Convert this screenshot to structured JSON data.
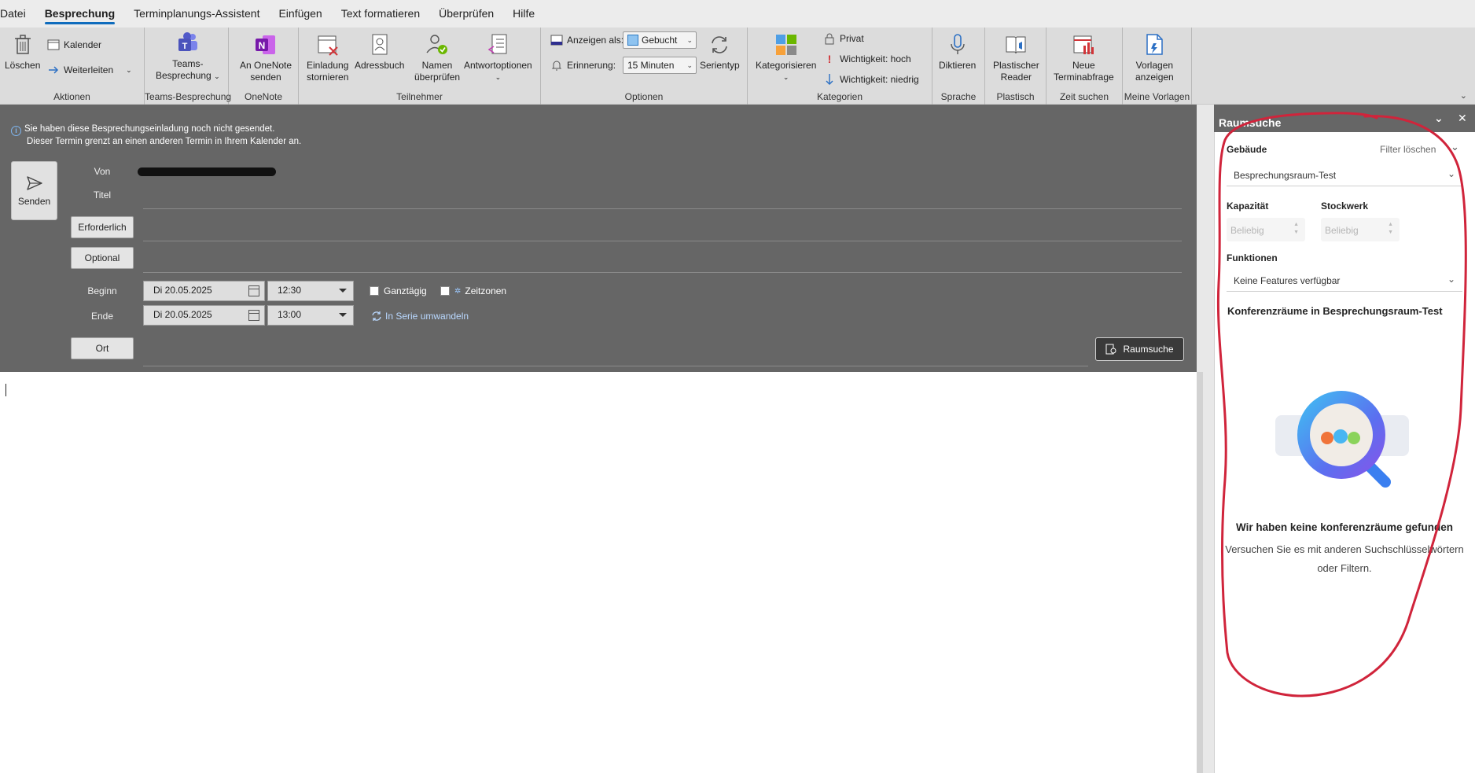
{
  "menu": {
    "items": [
      "Datei",
      "Besprechung",
      "Terminplanungs-Assistent",
      "Einfügen",
      "Text formatieren",
      "Überprüfen",
      "Hilfe"
    ],
    "active_index": 1
  },
  "ribbon": {
    "aktionen": {
      "loeschen": "Löschen",
      "kalender": "Kalender",
      "weiterleiten": "Weiterleiten",
      "group": "Aktionen"
    },
    "teams": {
      "btn_line1": "Teams-",
      "btn_line2": "Besprechung",
      "group": "Teams-Besprechung"
    },
    "onenote": {
      "btn_line1": "An OneNote",
      "btn_line2": "senden",
      "group": "OneNote"
    },
    "teilnehmer": {
      "einladung_l1": "Einladung",
      "einladung_l2": "stornieren",
      "adressbuch": "Adressbuch",
      "namen_l1": "Namen",
      "namen_l2": "überprüfen",
      "antwort": "Antwortoptionen",
      "group": "Teilnehmer"
    },
    "optionen": {
      "anzeigen_label": "Anzeigen als:",
      "anzeigen_value": "Gebucht",
      "erinnerung_label": "Erinnerung:",
      "erinnerung_value": "15 Minuten",
      "serientyp": "Serientyp",
      "group": "Optionen"
    },
    "kategorien": {
      "kategorisieren": "Kategorisieren",
      "privat": "Privat",
      "hoch": "Wichtigkeit: hoch",
      "niedrig": "Wichtigkeit: niedrig",
      "group": "Kategorien"
    },
    "sprache": {
      "diktieren": "Diktieren",
      "group": "Sprache"
    },
    "plastisch": {
      "l1": "Plastischer",
      "l2": "Reader",
      "group": "Plastisch"
    },
    "zeit": {
      "l1": "Neue",
      "l2": "Terminabfrage",
      "group": "Zeit suchen"
    },
    "vorlagen": {
      "l1": "Vorlagen",
      "l2": "anzeigen",
      "group": "Meine Vorlagen"
    }
  },
  "form": {
    "info_line1": "Sie haben diese Besprechungseinladung noch nicht gesendet.",
    "info_line2": "Dieser Termin grenzt an einen anderen Termin in Ihrem Kalender an.",
    "send": "Senden",
    "von": "Von",
    "titel": "Titel",
    "erforderlich": "Erforderlich",
    "optional": "Optional",
    "beginn": "Beginn",
    "ende": "Ende",
    "start_date": "Di 20.05.2025",
    "start_time": "12:30",
    "end_date": "Di 20.05.2025",
    "end_time": "13:00",
    "ganztaegig": "Ganztägig",
    "zeitzonen": "Zeitzonen",
    "serie": "In Serie umwandeln",
    "ort": "Ort",
    "raumsuche_btn": "Raumsuche"
  },
  "pane": {
    "title": "Raumsuche",
    "gebaeude": "Gebäude",
    "filter_loeschen": "Filter löschen",
    "gebaeude_value": "Besprechungsraum-Test",
    "kapazitaet": "Kapazität",
    "stockwerk": "Stockwerk",
    "kapazitaet_value": "Beliebig",
    "stockwerk_value": "Beliebig",
    "funktionen": "Funktionen",
    "funktionen_value": "Keine Features verfügbar",
    "results_heading": "Konferenzräume in Besprechungsraum-Test",
    "empty_title": "Wir haben keine konferenzräume gefunden",
    "empty_sub_line1": "Versuchen Sie es mit anderen Suchschlüsselwörtern",
    "empty_sub_line2": "oder Filtern.",
    "annotation_color": "#d0243b"
  },
  "colors": {
    "accent": "#0f6cbd",
    "form_bg": "#666666",
    "ribbon_bg": "#dcdcdc"
  }
}
